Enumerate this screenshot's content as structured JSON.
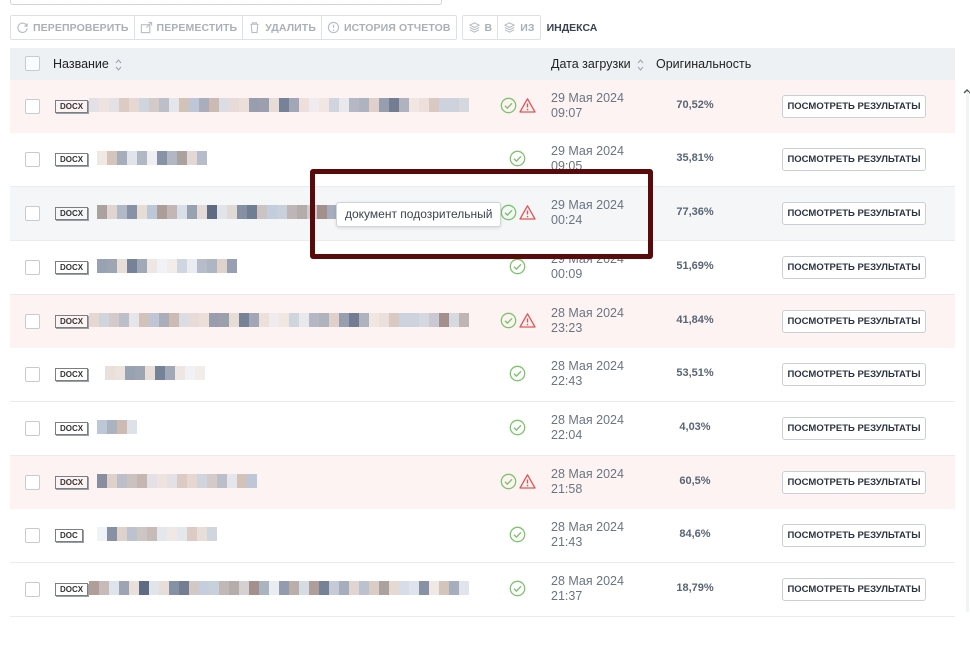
{
  "toolbar": {
    "recheck_label": "ПЕРЕПРОВЕРИТЬ",
    "move_label": "ПЕРЕМЕСТИТЬ",
    "delete_label": "УДАЛИТЬ",
    "history_label": "ИСТОРИЯ ОТЧЕТОВ",
    "to_index_label": "В",
    "from_index_label": "ИЗ",
    "index_label": "ИНДЕКСА"
  },
  "table": {
    "columns": {
      "name": "Название",
      "date": "Дата загрузки",
      "originality": "Оригинальность"
    },
    "results_button_label": "ПОСМОТРЕТЬ РЕЗУЛЬТАТЫ",
    "rows": [
      {
        "type": "DOCX",
        "date": "29 Мая 2024",
        "time": "09:07",
        "originality": "70,52%",
        "suspicious": true
      },
      {
        "type": "DOCX",
        "date": "29 Мая 2024",
        "time": "09:05",
        "originality": "35,81%",
        "suspicious": false
      },
      {
        "type": "DOCX",
        "date": "29 Мая 2024",
        "time": "00:24",
        "originality": "77,36%",
        "suspicious": true
      },
      {
        "type": "DOCX",
        "date": "29 Мая 2024",
        "time": "00:09",
        "originality": "51,69%",
        "suspicious": false
      },
      {
        "type": "DOCX",
        "date": "28 Мая 2024",
        "time": "23:23",
        "originality": "41,84%",
        "suspicious": true
      },
      {
        "type": "DOCX",
        "date": "28 Мая 2024",
        "time": "22:43",
        "originality": "53,51%",
        "suspicious": false
      },
      {
        "type": "DOCX",
        "date": "28 Мая 2024",
        "time": "22:04",
        "originality": "4,03%",
        "suspicious": false
      },
      {
        "type": "DOCX",
        "date": "28 Мая 2024",
        "time": "21:58",
        "originality": "60,5%",
        "suspicious": true
      },
      {
        "type": "DOC",
        "date": "28 Мая 2024",
        "time": "21:43",
        "originality": "84,6%",
        "suspicious": false
      },
      {
        "type": "DOCX",
        "date": "28 Мая 2024",
        "time": "21:37",
        "originality": "18,79%",
        "suspicious": false
      }
    ]
  },
  "tooltip": {
    "text": "документ подозрительный"
  },
  "colors": {
    "ok_icon": "#7cc36b",
    "warn_icon": "#e05555",
    "flagged_row_bg": "#fdf3f3",
    "highlight_border": "#5a0a0a"
  },
  "icons": {
    "recheck": "refresh-icon",
    "move": "move-icon",
    "delete": "trash-icon",
    "history": "history-icon",
    "index": "layers-icon",
    "sort": "sort-icon",
    "ok": "check-circle-icon",
    "warn": "warning-triangle-icon"
  }
}
